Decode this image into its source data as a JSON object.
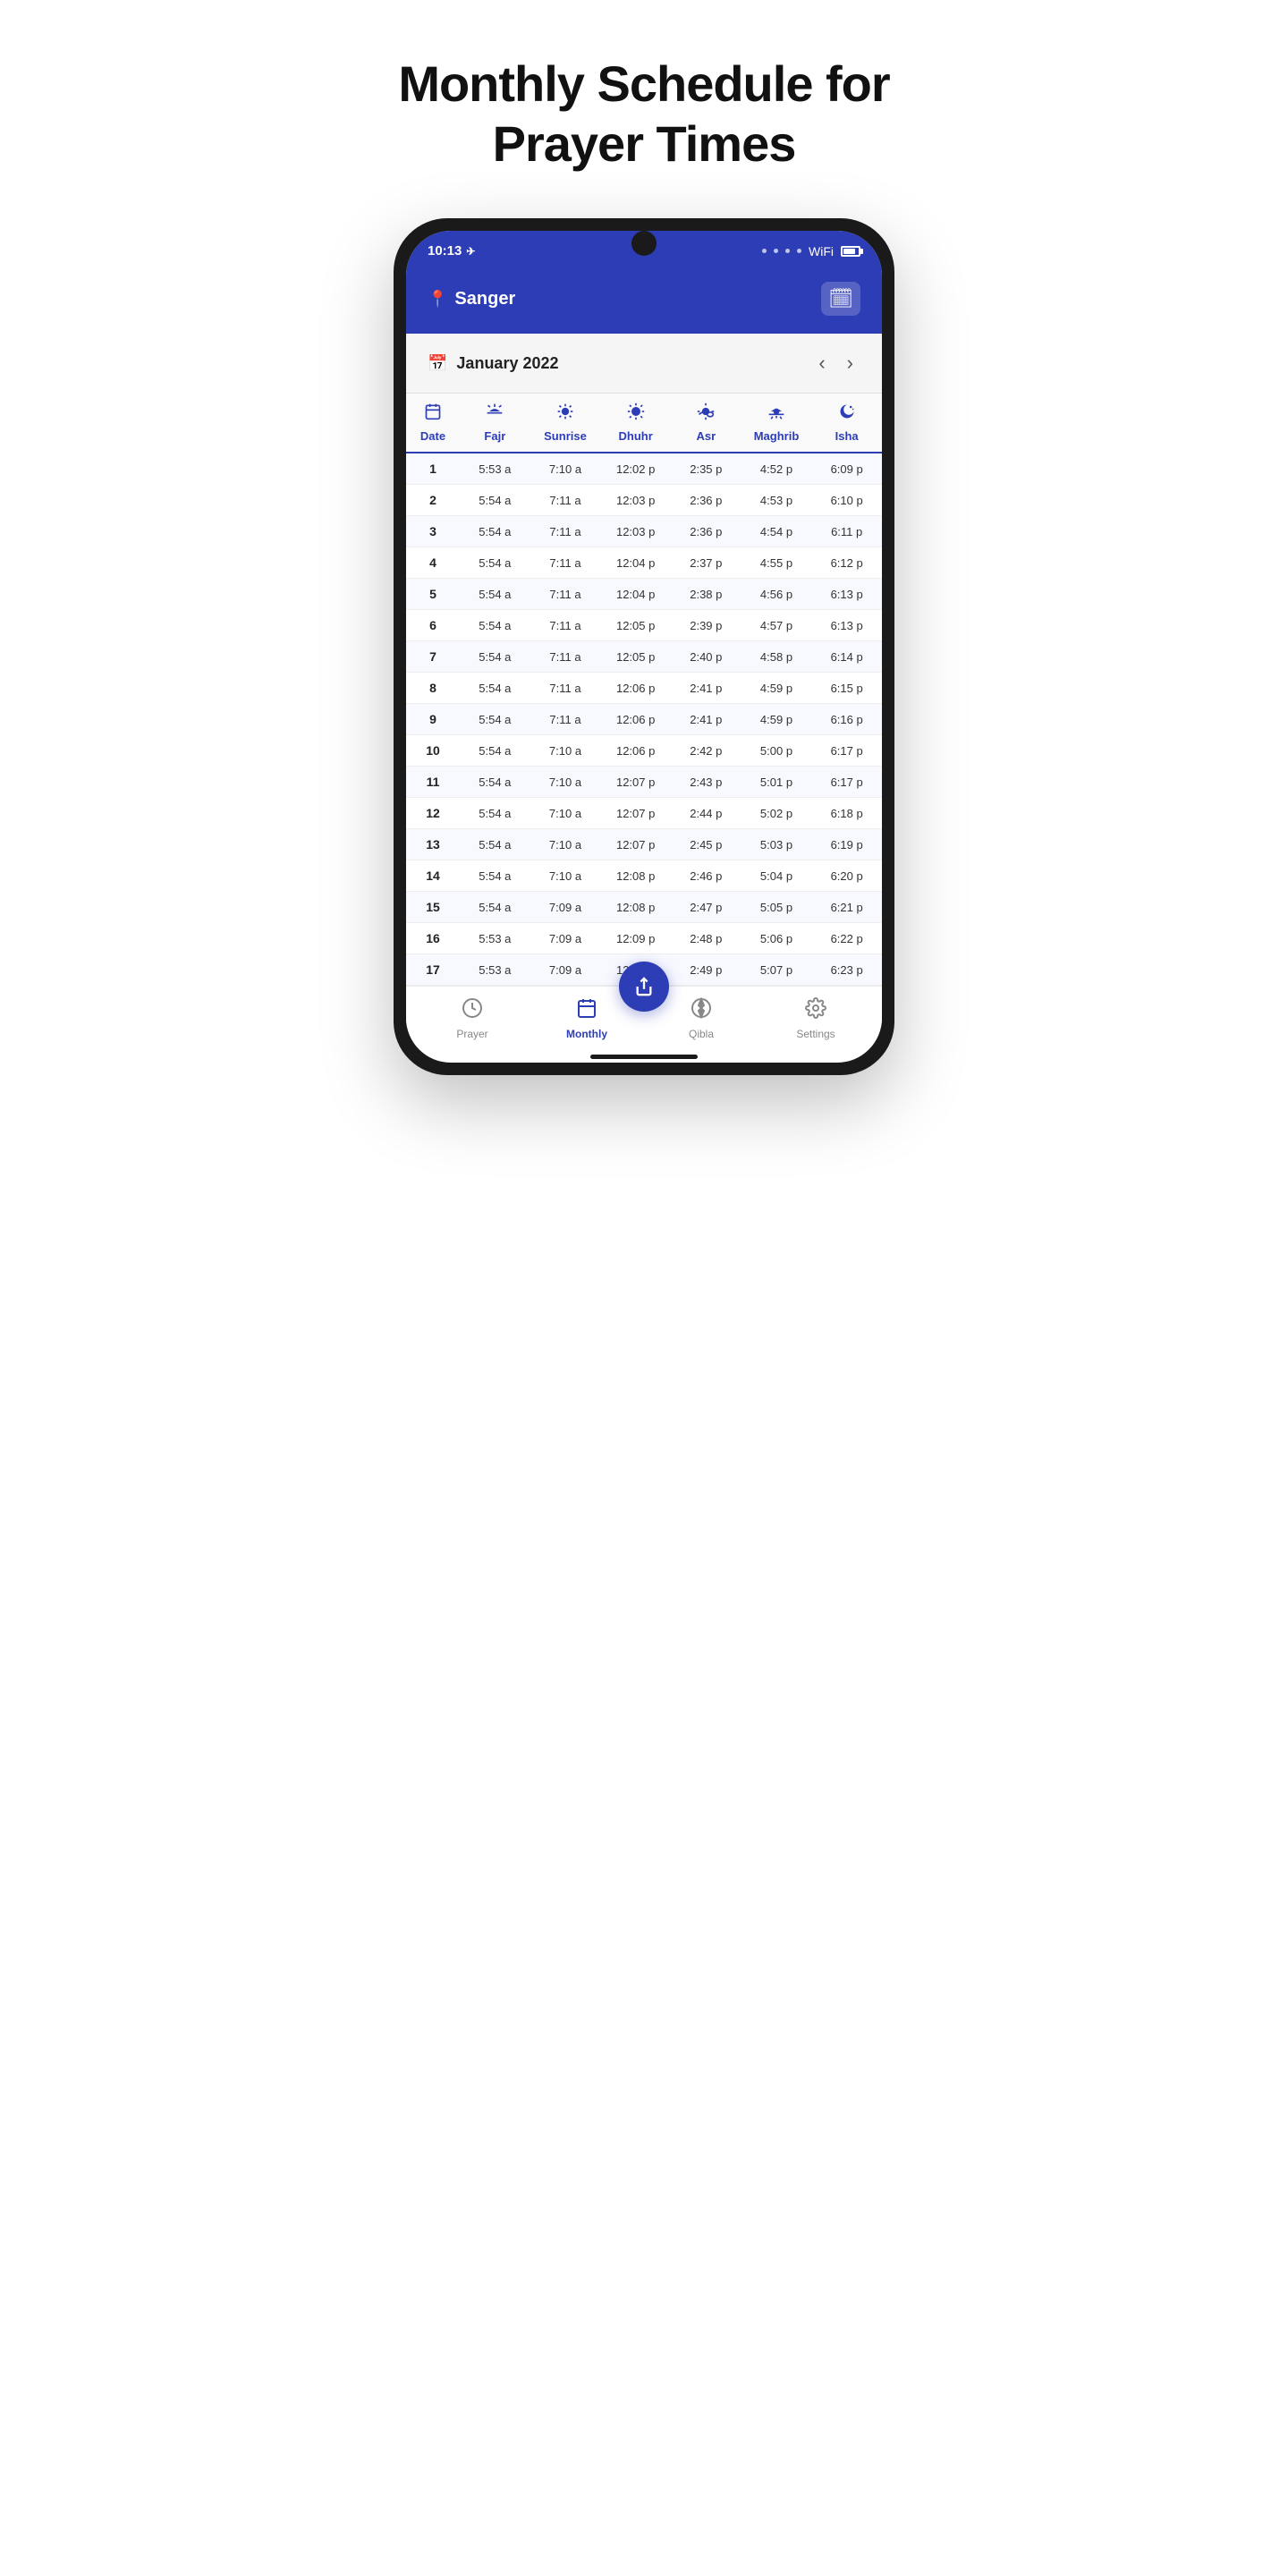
{
  "page": {
    "title": "Monthly Schedule for Prayer Times"
  },
  "header": {
    "time": "10:13",
    "location": "Sanger",
    "calendar_icon": "🗓"
  },
  "month_nav": {
    "month": "January  2022",
    "prev_label": "‹",
    "next_label": "›"
  },
  "table": {
    "columns": [
      {
        "id": "date",
        "label": "Date",
        "icon": "📅"
      },
      {
        "id": "fajr",
        "label": "Fajr",
        "icon": "fajr"
      },
      {
        "id": "sunrise",
        "label": "Sunrise",
        "icon": "sunrise"
      },
      {
        "id": "dhuhr",
        "label": "Dhuhr",
        "icon": "dhuhr"
      },
      {
        "id": "asr",
        "label": "Asr",
        "icon": "asr"
      },
      {
        "id": "maghrib",
        "label": "Maghrib",
        "icon": "maghrib"
      },
      {
        "id": "isha",
        "label": "Isha",
        "icon": "isha"
      }
    ],
    "rows": [
      {
        "date": "1",
        "fajr": "5:53 a",
        "sunrise": "7:10 a",
        "dhuhr": "12:02 p",
        "asr": "2:35 p",
        "maghrib": "4:52 p",
        "isha": "6:09 p"
      },
      {
        "date": "2",
        "fajr": "5:54 a",
        "sunrise": "7:11 a",
        "dhuhr": "12:03 p",
        "asr": "2:36 p",
        "maghrib": "4:53 p",
        "isha": "6:10 p"
      },
      {
        "date": "3",
        "fajr": "5:54 a",
        "sunrise": "7:11 a",
        "dhuhr": "12:03 p",
        "asr": "2:36 p",
        "maghrib": "4:54 p",
        "isha": "6:11 p"
      },
      {
        "date": "4",
        "fajr": "5:54 a",
        "sunrise": "7:11 a",
        "dhuhr": "12:04 p",
        "asr": "2:37 p",
        "maghrib": "4:55 p",
        "isha": "6:12 p"
      },
      {
        "date": "5",
        "fajr": "5:54 a",
        "sunrise": "7:11 a",
        "dhuhr": "12:04 p",
        "asr": "2:38 p",
        "maghrib": "4:56 p",
        "isha": "6:13 p"
      },
      {
        "date": "6",
        "fajr": "5:54 a",
        "sunrise": "7:11 a",
        "dhuhr": "12:05 p",
        "asr": "2:39 p",
        "maghrib": "4:57 p",
        "isha": "6:13 p"
      },
      {
        "date": "7",
        "fajr": "5:54 a",
        "sunrise": "7:11 a",
        "dhuhr": "12:05 p",
        "asr": "2:40 p",
        "maghrib": "4:58 p",
        "isha": "6:14 p"
      },
      {
        "date": "8",
        "fajr": "5:54 a",
        "sunrise": "7:11 a",
        "dhuhr": "12:06 p",
        "asr": "2:41 p",
        "maghrib": "4:59 p",
        "isha": "6:15 p"
      },
      {
        "date": "9",
        "fajr": "5:54 a",
        "sunrise": "7:11 a",
        "dhuhr": "12:06 p",
        "asr": "2:41 p",
        "maghrib": "4:59 p",
        "isha": "6:16 p"
      },
      {
        "date": "10",
        "fajr": "5:54 a",
        "sunrise": "7:10 a",
        "dhuhr": "12:06 p",
        "asr": "2:42 p",
        "maghrib": "5:00 p",
        "isha": "6:17 p"
      },
      {
        "date": "11",
        "fajr": "5:54 a",
        "sunrise": "7:10 a",
        "dhuhr": "12:07 p",
        "asr": "2:43 p",
        "maghrib": "5:01 p",
        "isha": "6:17 p"
      },
      {
        "date": "12",
        "fajr": "5:54 a",
        "sunrise": "7:10 a",
        "dhuhr": "12:07 p",
        "asr": "2:44 p",
        "maghrib": "5:02 p",
        "isha": "6:18 p"
      },
      {
        "date": "13",
        "fajr": "5:54 a",
        "sunrise": "7:10 a",
        "dhuhr": "12:07 p",
        "asr": "2:45 p",
        "maghrib": "5:03 p",
        "isha": "6:19 p"
      },
      {
        "date": "14",
        "fajr": "5:54 a",
        "sunrise": "7:10 a",
        "dhuhr": "12:08 p",
        "asr": "2:46 p",
        "maghrib": "5:04 p",
        "isha": "6:20 p"
      },
      {
        "date": "15",
        "fajr": "5:54 a",
        "sunrise": "7:09 a",
        "dhuhr": "12:08 p",
        "asr": "2:47 p",
        "maghrib": "5:05 p",
        "isha": "6:21 p"
      },
      {
        "date": "16",
        "fajr": "5:53 a",
        "sunrise": "7:09 a",
        "dhuhr": "12:09 p",
        "asr": "2:48 p",
        "maghrib": "5:06 p",
        "isha": "6:22 p"
      },
      {
        "date": "17",
        "fajr": "5:53 a",
        "sunrise": "7:09 a",
        "dhuhr": "12:09 p",
        "asr": "2:49 p",
        "maghrib": "5:07 p",
        "isha": "6:23 p"
      }
    ]
  },
  "bottom_nav": {
    "items": [
      {
        "id": "prayer",
        "label": "Prayer",
        "icon": "clock",
        "active": false
      },
      {
        "id": "monthly",
        "label": "Monthly",
        "icon": "calendar",
        "active": true
      },
      {
        "id": "qibla",
        "label": "Qibla",
        "icon": "compass",
        "active": false
      },
      {
        "id": "settings",
        "label": "Settings",
        "icon": "settings",
        "active": false
      }
    ],
    "fab_icon": "↑"
  },
  "colors": {
    "primary": "#2d3db5",
    "active_nav": "#2d3db5",
    "inactive_nav": "#888888"
  }
}
